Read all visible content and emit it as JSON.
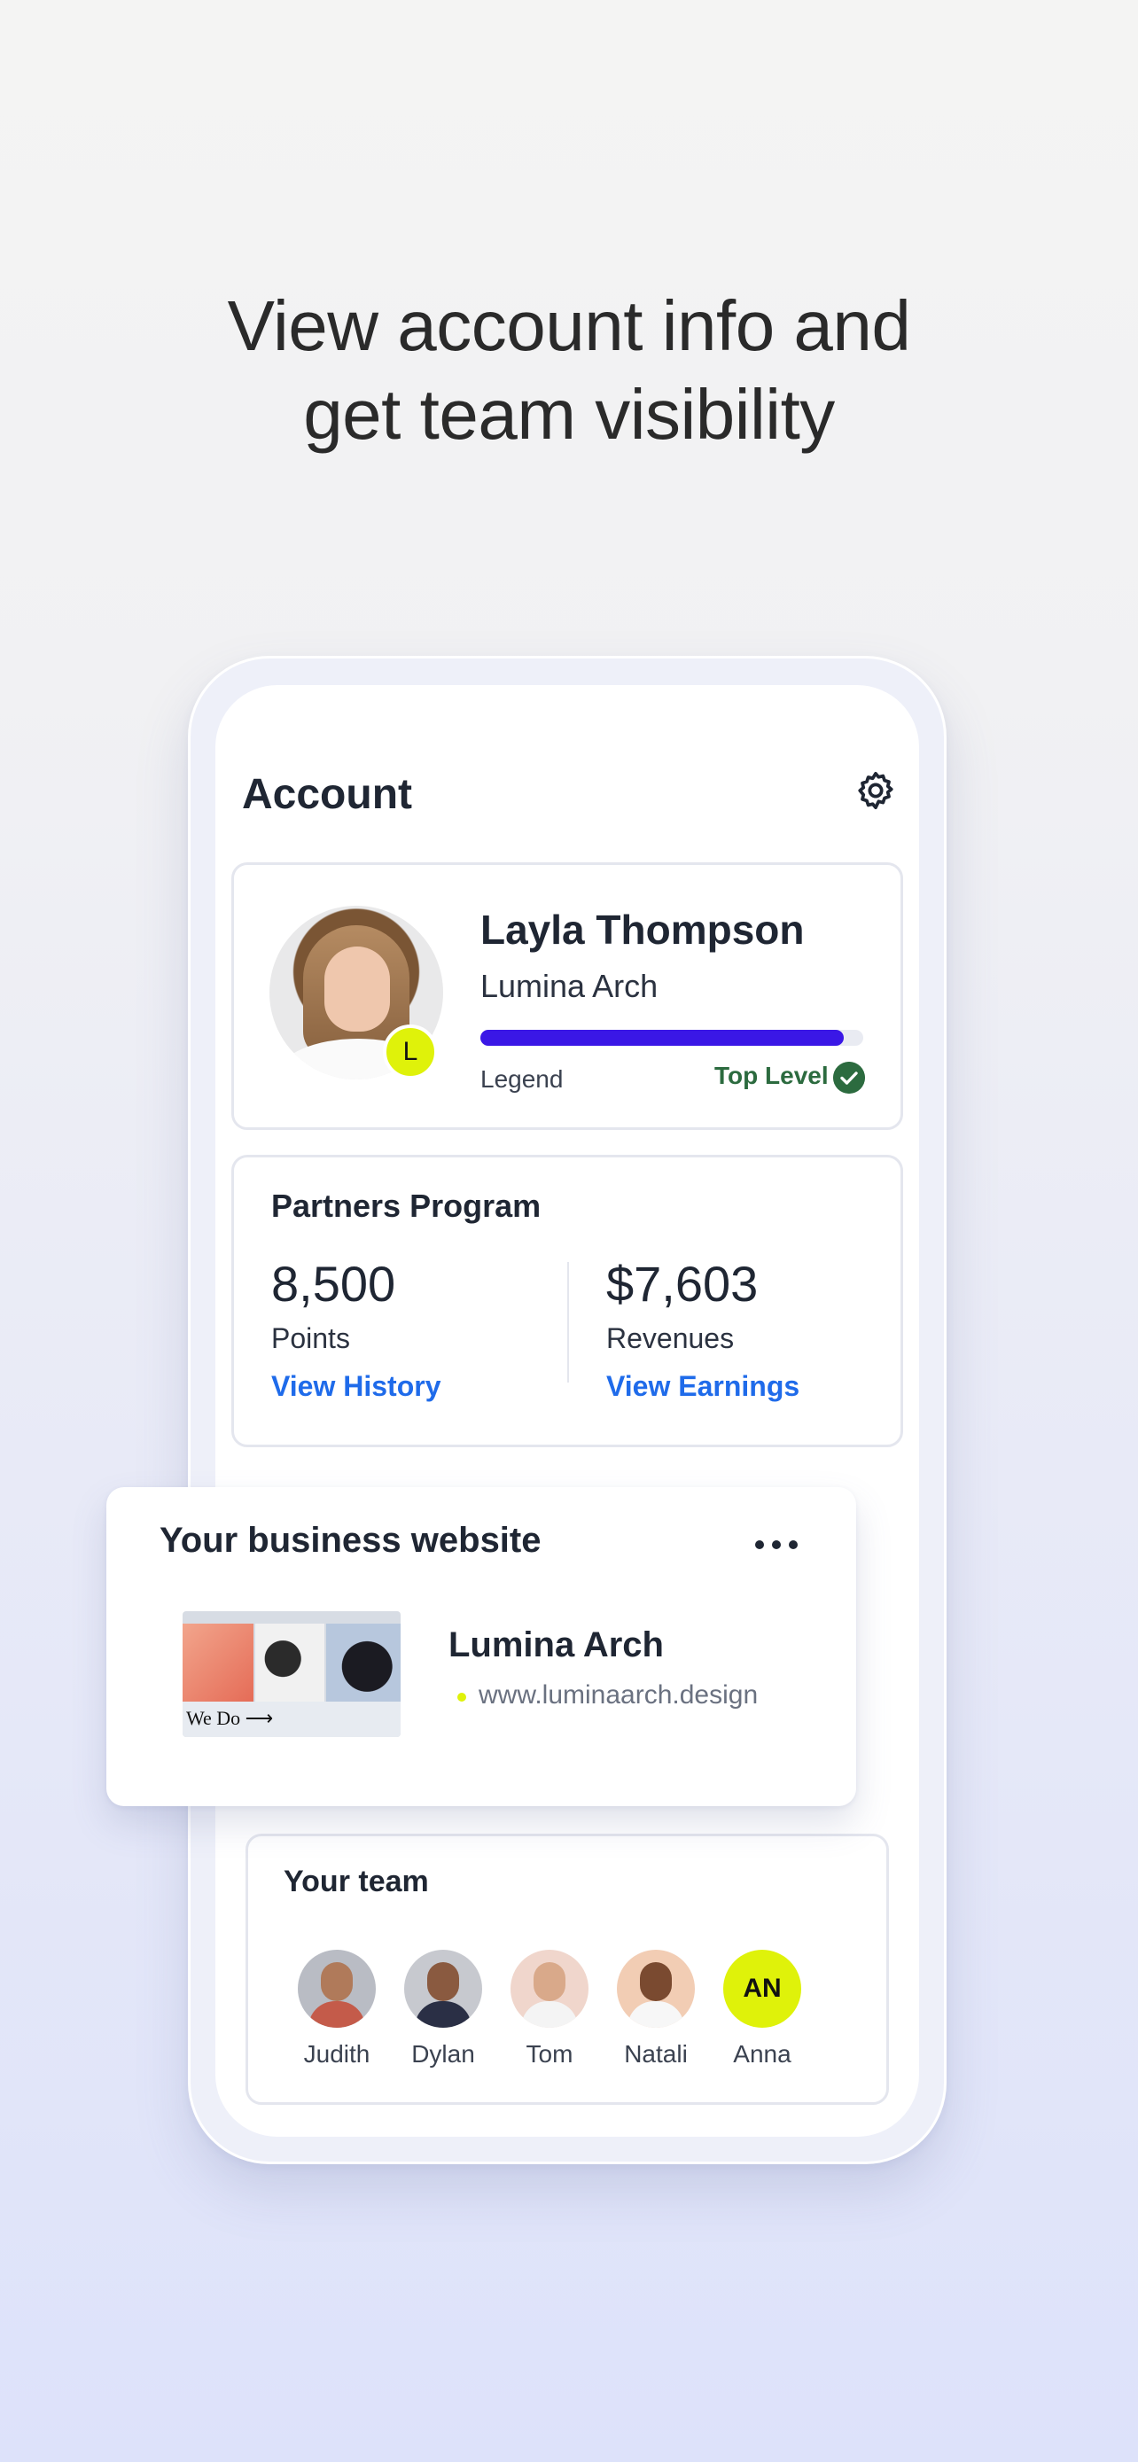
{
  "headline": {
    "line1": "View account info and",
    "line2": "get team visibility"
  },
  "account": {
    "title": "Account",
    "settings_icon": "gear-icon"
  },
  "profile": {
    "name": "Layla Thompson",
    "company": "Lumina Arch",
    "badge": "L",
    "progress": 0.95,
    "level_left": "Legend",
    "level_right": "Top Level",
    "accent": "#3a17e6",
    "success": "#2c6b3f"
  },
  "partners": {
    "title": "Partners Program",
    "points_value": "8,500",
    "points_label": "Points",
    "points_link": "View History",
    "revenue_value": "$7,603",
    "revenue_label": "Revenues",
    "revenue_link": "View Earnings",
    "link_color": "#1f6bea"
  },
  "business": {
    "title": "Your business website",
    "site_name": "Lumina Arch",
    "url": "www.luminaarch.design",
    "thumb_caption": "We Do ⟶"
  },
  "team": {
    "title": "Your team",
    "members": [
      {
        "name": "Judith"
      },
      {
        "name": "Dylan"
      },
      {
        "name": "Tom"
      },
      {
        "name": "Natali"
      },
      {
        "name": "Anna",
        "initials": "AN"
      }
    ]
  }
}
